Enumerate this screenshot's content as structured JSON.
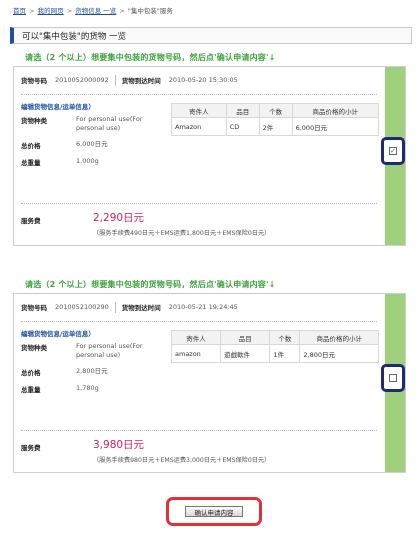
{
  "breadcrumb": {
    "home": "首页",
    "mypage": "我的网页",
    "shipment": "货物信息 一览",
    "current": "\"集中包装\"服务",
    "separator": ">"
  },
  "page_title": "可以\"集中包装\"的货物 一览",
  "instruction": "请选（2 个以上）想要集中包装的货物号码，然后点'确认申请内容'",
  "instruction_arrow": "↓",
  "labels": {
    "cargo_no": "货物号码",
    "arrival_time": "货物到达时间",
    "edit_link": "编辑货物信息/运单信息）",
    "cargo_type": "货物种类",
    "total_price": "总价格",
    "total_weight": "总重量",
    "service_fee": "服务费"
  },
  "table_headers": [
    "寄件人",
    "品目",
    "个数",
    "商品价格的小计"
  ],
  "items": [
    {
      "cargo_no": "2010052000092",
      "arrival_time": "2010-05-20 15:30:05",
      "cargo_type": "For personal use(For personal use)",
      "total_price": "6,000日元",
      "total_weight": "1,000g",
      "row": [
        "Amazon",
        "CD",
        "2件",
        "6,000日元"
      ],
      "fee_amount": "2,290日元",
      "fee_detail": "（服务手续费490日元＋EMS运费1,800日元＋EMS保险0日元）",
      "checked": true,
      "check_glyph": "✓"
    },
    {
      "cargo_no": "2010052100290",
      "arrival_time": "2010-05-21 19:24:45",
      "cargo_type": "For personal use(For personal use)",
      "total_price": "2,800日元",
      "total_weight": "1,780g",
      "row": [
        "amazon",
        "遊戯軟件",
        "1件",
        "2,800日元"
      ],
      "fee_amount": "3,980日元",
      "fee_detail": "（服务手续费980日元＋EMS运费3,000日元＋EMS保险0日元）",
      "checked": false,
      "check_glyph": ""
    }
  ],
  "confirm_button": "确认申请内容",
  "colors": {
    "accent_green": "#9fd07c",
    "instruction_green": "#3fa33f",
    "fee_pink": "#d0205f",
    "ring_navy": "#1d2a78",
    "ring_red": "#e0303a",
    "link_blue": "#1f4fa5"
  }
}
